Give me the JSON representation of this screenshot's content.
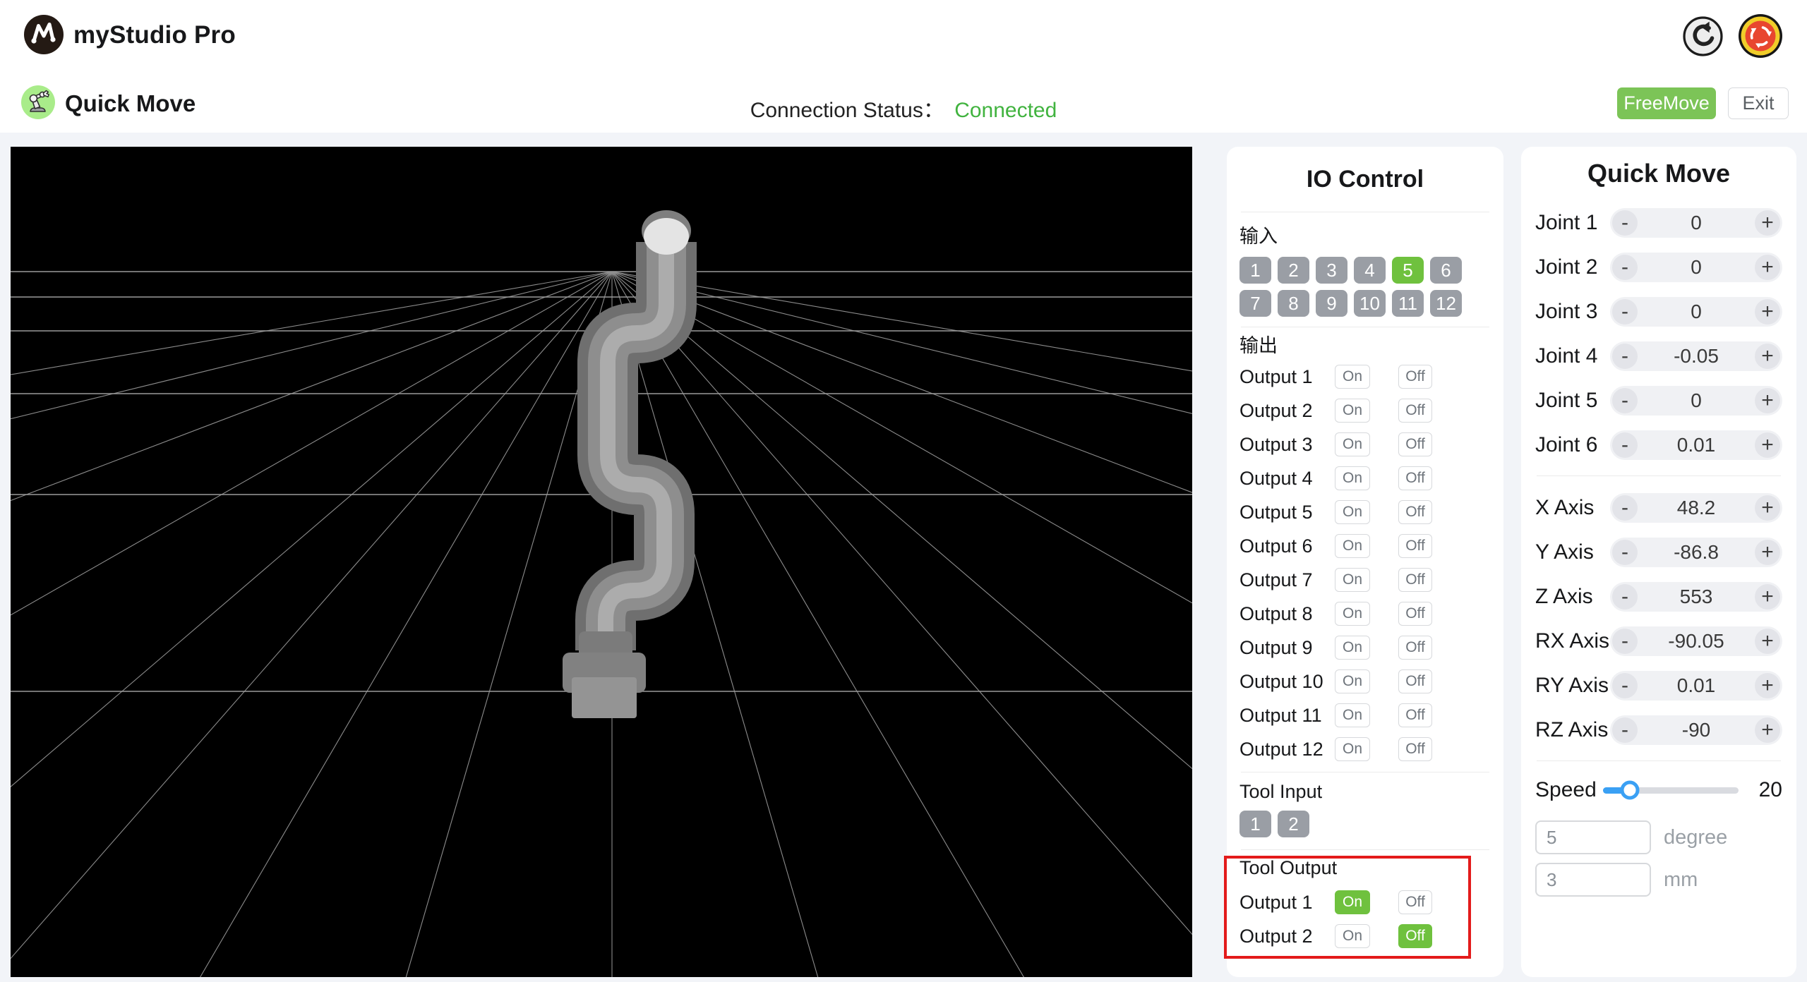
{
  "header": {
    "app_title": "myStudio Pro",
    "page_title": "Quick Move",
    "connection_label": "Connection Status：",
    "connection_status": "Connected",
    "freemove_label": "FreeMove",
    "exit_label": "Exit"
  },
  "io_control": {
    "title": "IO Control",
    "input_label": "输入",
    "input_buttons": [
      "1",
      "2",
      "3",
      "4",
      "5",
      "6",
      "7",
      "8",
      "9",
      "10",
      "11",
      "12"
    ],
    "active_input": "5",
    "output_label": "输出",
    "on_label": "On",
    "off_label": "Off",
    "outputs": [
      "Output 1",
      "Output 2",
      "Output 3",
      "Output 4",
      "Output 5",
      "Output 6",
      "Output 7",
      "Output 8",
      "Output 9",
      "Output 10",
      "Output 11",
      "Output 12"
    ],
    "tool_input_label": "Tool Input",
    "tool_input_buttons": [
      "1",
      "2"
    ],
    "tool_output_label": "Tool Output",
    "tool_outputs": [
      {
        "label": "Output 1",
        "state": "on"
      },
      {
        "label": "Output 2",
        "state": "off"
      }
    ]
  },
  "quick_move": {
    "title": "Quick Move",
    "minus_label": "-",
    "plus_label": "+",
    "joints": [
      {
        "label": "Joint 1",
        "value": "0"
      },
      {
        "label": "Joint 2",
        "value": "0"
      },
      {
        "label": "Joint 3",
        "value": "0"
      },
      {
        "label": "Joint 4",
        "value": "-0.05"
      },
      {
        "label": "Joint 5",
        "value": "0"
      },
      {
        "label": "Joint 6",
        "value": "0.01"
      }
    ],
    "axes": [
      {
        "label": "X Axis",
        "value": "48.2"
      },
      {
        "label": "Y Axis",
        "value": "-86.8"
      },
      {
        "label": "Z Axis",
        "value": "553"
      },
      {
        "label": "RX Axis",
        "value": "-90.05"
      },
      {
        "label": "RY Axis",
        "value": "0.01"
      },
      {
        "label": "RZ Axis",
        "value": "-90"
      }
    ],
    "speed_label": "Speed",
    "speed_value": "20",
    "step_inputs": [
      {
        "value": "5",
        "unit": "degree"
      },
      {
        "value": "3",
        "unit": "mm"
      }
    ]
  },
  "colors": {
    "accent_green": "#6fc13e",
    "freemove_green": "#7cc457",
    "connected_green": "#41b33f",
    "slider_blue": "#3aa0f4",
    "annotation_red": "#e31b1b",
    "estop_red": "#e8462f",
    "estop_yellow": "#f0cd2a",
    "page_bg": "#f2f4f8"
  }
}
